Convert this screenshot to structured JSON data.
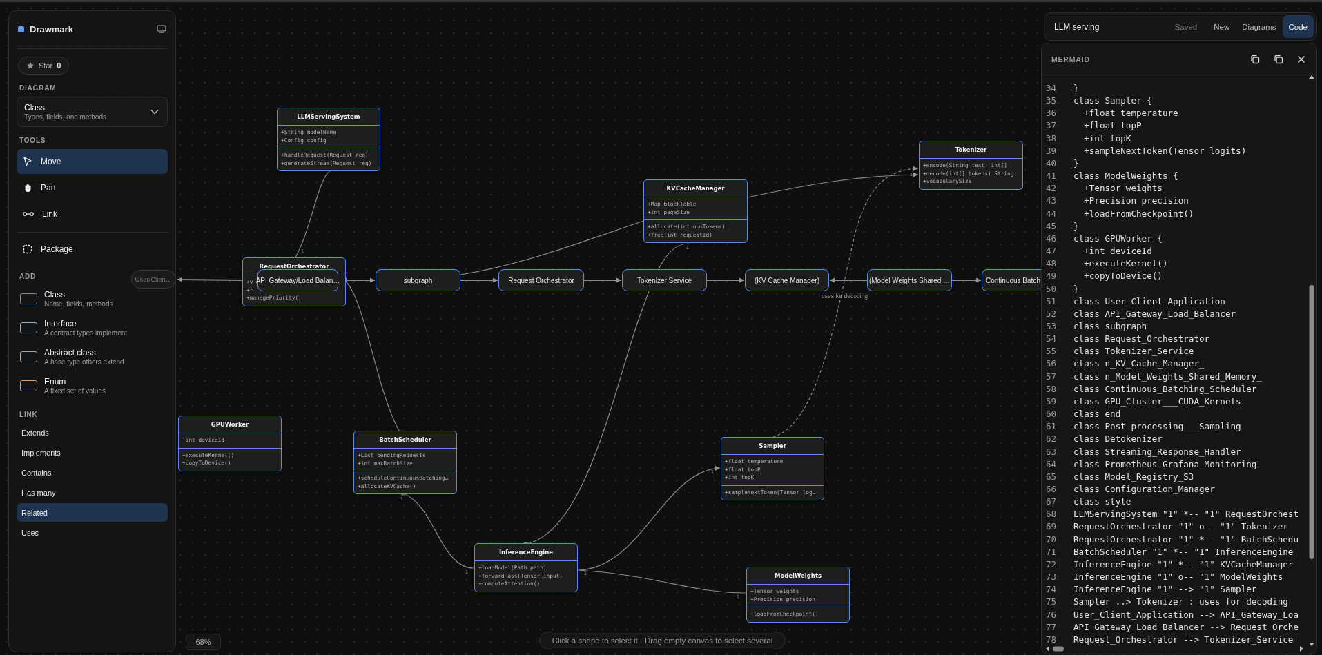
{
  "sidebar": {
    "brand": "Drawmark",
    "star_label": "Star",
    "star_count": "0",
    "diagram_heading": "DIAGRAM",
    "diagram_type": {
      "name": "Class",
      "description": "Types, fields, and methods"
    },
    "tools_heading": "TOOLS",
    "tools": [
      {
        "label": "Move",
        "selected": true
      },
      {
        "label": "Pan",
        "selected": false
      },
      {
        "label": "Link",
        "selected": false
      }
    ],
    "package": {
      "label": "Package"
    },
    "add_heading": "ADD",
    "shapes": [
      {
        "name": "Class",
        "description": "Name, fields, methods",
        "color": "#5b8def"
      },
      {
        "name": "Interface",
        "description": "A contract types implement",
        "color": "#7fb0d8"
      },
      {
        "name": "Abstract class",
        "description": "A base type others extend",
        "color": "#9aaec4"
      },
      {
        "name": "Enum",
        "description": "A fixed set of values",
        "color": "#d9a066"
      }
    ],
    "link_heading": "LINK",
    "links": [
      {
        "label": "Extends",
        "selected": false
      },
      {
        "label": "Implements",
        "selected": false
      },
      {
        "label": "Contains",
        "selected": false
      },
      {
        "label": "Has many",
        "selected": false
      },
      {
        "label": "Related",
        "selected": true
      },
      {
        "label": "Uses",
        "selected": false
      }
    ]
  },
  "canvas": {
    "classes": [
      {
        "name": "LLMServingSystem",
        "attributes": [
          "+String modelName",
          "+Config config"
        ],
        "methods": [
          "+handleRequest(Request req)",
          "+generateStream(Request req)"
        ]
      },
      {
        "name": "Tokenizer",
        "methods": [
          "+encode(String text) int[]",
          "+decode(int[] tokens) String",
          "+vocabularySize"
        ]
      },
      {
        "name": "KVCacheManager",
        "attributes": [
          "+Map blockTable",
          "+int pageSize"
        ],
        "methods": [
          "+allocate(int numTokens)",
          "+free(int requestId)"
        ]
      },
      {
        "name": "RequestOrchestrator",
        "methods": [
          "+v",
          "+r",
          "+managePriority()"
        ]
      },
      {
        "name": "GPUWorker",
        "attributes": [
          "+int deviceId"
        ],
        "methods": [
          "+executeKernel()",
          "+copyToDevice()"
        ]
      },
      {
        "name": "BatchScheduler",
        "attributes": [
          "+List pendingRequests",
          "+int maxBatchSize"
        ],
        "methods": [
          "+scheduleContinuousBatching…",
          "+allocateKVCache()"
        ]
      },
      {
        "name": "Sampler",
        "attributes": [
          "+float temperature",
          "+float topP",
          "+int topK"
        ],
        "methods": [
          "+sampleNextToken(Tensor log…"
        ]
      },
      {
        "name": "InferenceEngine",
        "methods": [
          "+loadModel(Path path)",
          "+forwardPass(Tensor input)",
          "+computeAttention()"
        ]
      },
      {
        "name": "ModelWeights",
        "attributes": [
          "+Tensor weights",
          "+Precision precision"
        ],
        "methods": [
          "+loadFromCheckpoint()"
        ]
      }
    ],
    "nodes": [
      {
        "label": "User/Clien…"
      },
      {
        "label": "API Gateway/Load Balan…"
      },
      {
        "label": "subgraph"
      },
      {
        "label": "Request Orchestrator"
      },
      {
        "label": "Tokenizer Service"
      },
      {
        "label": "(KV Cache Manager)"
      },
      {
        "label": "(Model Weights Shared …"
      },
      {
        "label": "Continuous Batch"
      }
    ],
    "connectors": [
      {
        "kind": "composition",
        "end_labels": [
          "1"
        ]
      },
      {
        "kind": "composition"
      },
      {
        "kind": "composition",
        "end_labels": [
          "1",
          "1"
        ]
      },
      {
        "kind": "composition",
        "end_labels": [
          "1"
        ]
      },
      {
        "kind": "aggregation",
        "end_labels": [
          "1",
          "1"
        ]
      },
      {
        "kind": "association",
        "end_labels": [
          "1"
        ]
      },
      {
        "kind": "dependency",
        "label": "uses for decoding"
      },
      {
        "kind": "association",
        "end_labels": [
          "1"
        ]
      },
      {
        "kind": "plain"
      },
      {
        "kind": "flow"
      },
      {
        "kind": "flow"
      },
      {
        "kind": "flow"
      },
      {
        "kind": "flow"
      },
      {
        "kind": "flow"
      },
      {
        "kind": "flow"
      },
      {
        "kind": "flow"
      }
    ],
    "zoom": "68%",
    "hint": "Click a shape to select it · Drag empty canvas to select several"
  },
  "header": {
    "title": "LLM serving",
    "status": "Saved",
    "nav": [
      {
        "label": "New",
        "selected": false
      },
      {
        "label": "Diagrams",
        "selected": false
      },
      {
        "label": "Code",
        "selected": true
      }
    ]
  },
  "code_panel": {
    "title": "MERMAID",
    "lines": [
      {
        "number": "34",
        "text": "}"
      },
      {
        "number": "35",
        "text": "class Sampler {"
      },
      {
        "number": "36",
        "text": "  +float temperature"
      },
      {
        "number": "37",
        "text": "  +float topP"
      },
      {
        "number": "38",
        "text": "  +int topK"
      },
      {
        "number": "39",
        "text": "  +sampleNextToken(Tensor logits)"
      },
      {
        "number": "40",
        "text": "}"
      },
      {
        "number": "41",
        "text": "class ModelWeights {"
      },
      {
        "number": "42",
        "text": "  +Tensor weights"
      },
      {
        "number": "43",
        "text": "  +Precision precision"
      },
      {
        "number": "44",
        "text": "  +loadFromCheckpoint()"
      },
      {
        "number": "45",
        "text": "}"
      },
      {
        "number": "46",
        "text": "class GPUWorker {"
      },
      {
        "number": "47",
        "text": "  +int deviceId"
      },
      {
        "number": "48",
        "text": "  +executeKernel()"
      },
      {
        "number": "49",
        "text": "  +copyToDevice()"
      },
      {
        "number": "50",
        "text": "}"
      },
      {
        "number": "51",
        "text": "class User_Client_Application"
      },
      {
        "number": "52",
        "text": "class API_Gateway_Load_Balancer"
      },
      {
        "number": "53",
        "text": "class subgraph"
      },
      {
        "number": "54",
        "text": "class Request_Orchestrator"
      },
      {
        "number": "55",
        "text": "class Tokenizer_Service"
      },
      {
        "number": "56",
        "text": "class n_KV_Cache_Manager_"
      },
      {
        "number": "57",
        "text": "class n_Model_Weights_Shared_Memory_"
      },
      {
        "number": "58",
        "text": "class Continuous_Batching_Scheduler"
      },
      {
        "number": "59",
        "text": "class GPU_Cluster___CUDA_Kernels"
      },
      {
        "number": "60",
        "text": "class end"
      },
      {
        "number": "61",
        "text": "class Post_processing___Sampling"
      },
      {
        "number": "62",
        "text": "class Detokenizer"
      },
      {
        "number": "63",
        "text": "class Streaming_Response_Handler"
      },
      {
        "number": "64",
        "text": "class Prometheus_Grafana_Monitoring"
      },
      {
        "number": "65",
        "text": "class Model_Registry_S3"
      },
      {
        "number": "66",
        "text": "class Configuration_Manager"
      },
      {
        "number": "67",
        "text": "class style"
      },
      {
        "number": "68",
        "text": "LLMServingSystem \"1\" *-- \"1\" RequestOrchest"
      },
      {
        "number": "69",
        "text": "RequestOrchestrator \"1\" o-- \"1\" Tokenizer"
      },
      {
        "number": "70",
        "text": "RequestOrchestrator \"1\" *-- \"1\" BatchSchedu"
      },
      {
        "number": "71",
        "text": "BatchScheduler \"1\" *-- \"1\" InferenceEngine"
      },
      {
        "number": "72",
        "text": "InferenceEngine \"1\" *-- \"1\" KVCacheManager"
      },
      {
        "number": "73",
        "text": "InferenceEngine \"1\" o-- \"1\" ModelWeights"
      },
      {
        "number": "74",
        "text": "InferenceEngine \"1\" --> \"1\" Sampler"
      },
      {
        "number": "75",
        "text": "Sampler ..> Tokenizer : uses for decoding"
      },
      {
        "number": "76",
        "text": "User_Client_Application --> API_Gateway_Loa"
      },
      {
        "number": "77",
        "text": "API_Gateway_Load_Balancer --> Request_Orche"
      },
      {
        "number": "78",
        "text": "Request_Orchestrator --> Tokenizer_Service"
      }
    ]
  }
}
